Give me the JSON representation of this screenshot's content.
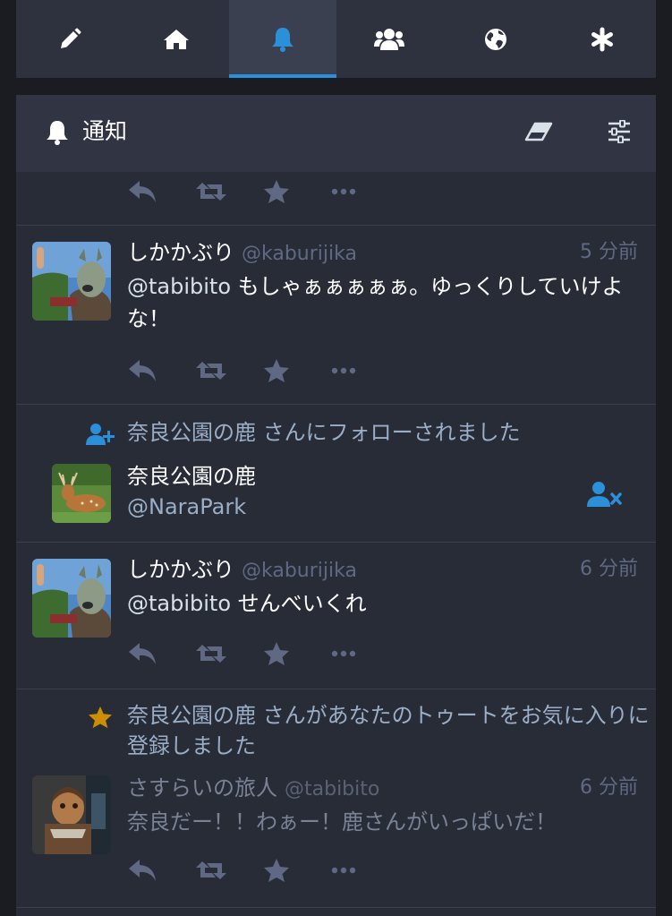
{
  "tabs": [
    {
      "name": "compose",
      "icon": "pencil-icon"
    },
    {
      "name": "home",
      "icon": "home-icon"
    },
    {
      "name": "notifications",
      "icon": "bell-icon",
      "active": true
    },
    {
      "name": "local",
      "icon": "users-icon"
    },
    {
      "name": "federated",
      "icon": "globe-icon"
    },
    {
      "name": "menu",
      "icon": "asterisk-icon"
    }
  ],
  "column": {
    "title": "通知",
    "title_icon": "bell-icon",
    "clear_icon": "eraser-icon",
    "settings_icon": "sliders-icon"
  },
  "notifications": [
    {
      "type": "status",
      "display_name": "しかかぶり",
      "acct": "@kaburijika",
      "time": "5 分前",
      "mention": "@tabibito",
      "text": " もしゃぁぁぁぁぁ。ゆっくりしていけよな！"
    },
    {
      "type": "follow",
      "message": "奈良公園の鹿 さんにフォローされました",
      "account_name": "奈良公園の鹿",
      "account_acct": "@NaraPark"
    },
    {
      "type": "status",
      "display_name": "しかかぶり",
      "acct": "@kaburijika",
      "time": "6 分前",
      "mention": "@tabibito",
      "text": " せんべいくれ"
    },
    {
      "type": "favourite",
      "message": "奈良公園の鹿 さんがあなたのトゥートをお気に入りに登録しました",
      "display_name": "さすらいの旅人",
      "acct": "@tabibito",
      "time": "6 分前",
      "text": "奈良だー！！わぁー！鹿さんがいっぱいだ！"
    }
  ],
  "colors": {
    "background": "#1a1c22",
    "panel": "#282c37",
    "header": "#313543",
    "accent": "#2b90d9",
    "muted": "#606984",
    "favourite": "#ca8f04"
  }
}
